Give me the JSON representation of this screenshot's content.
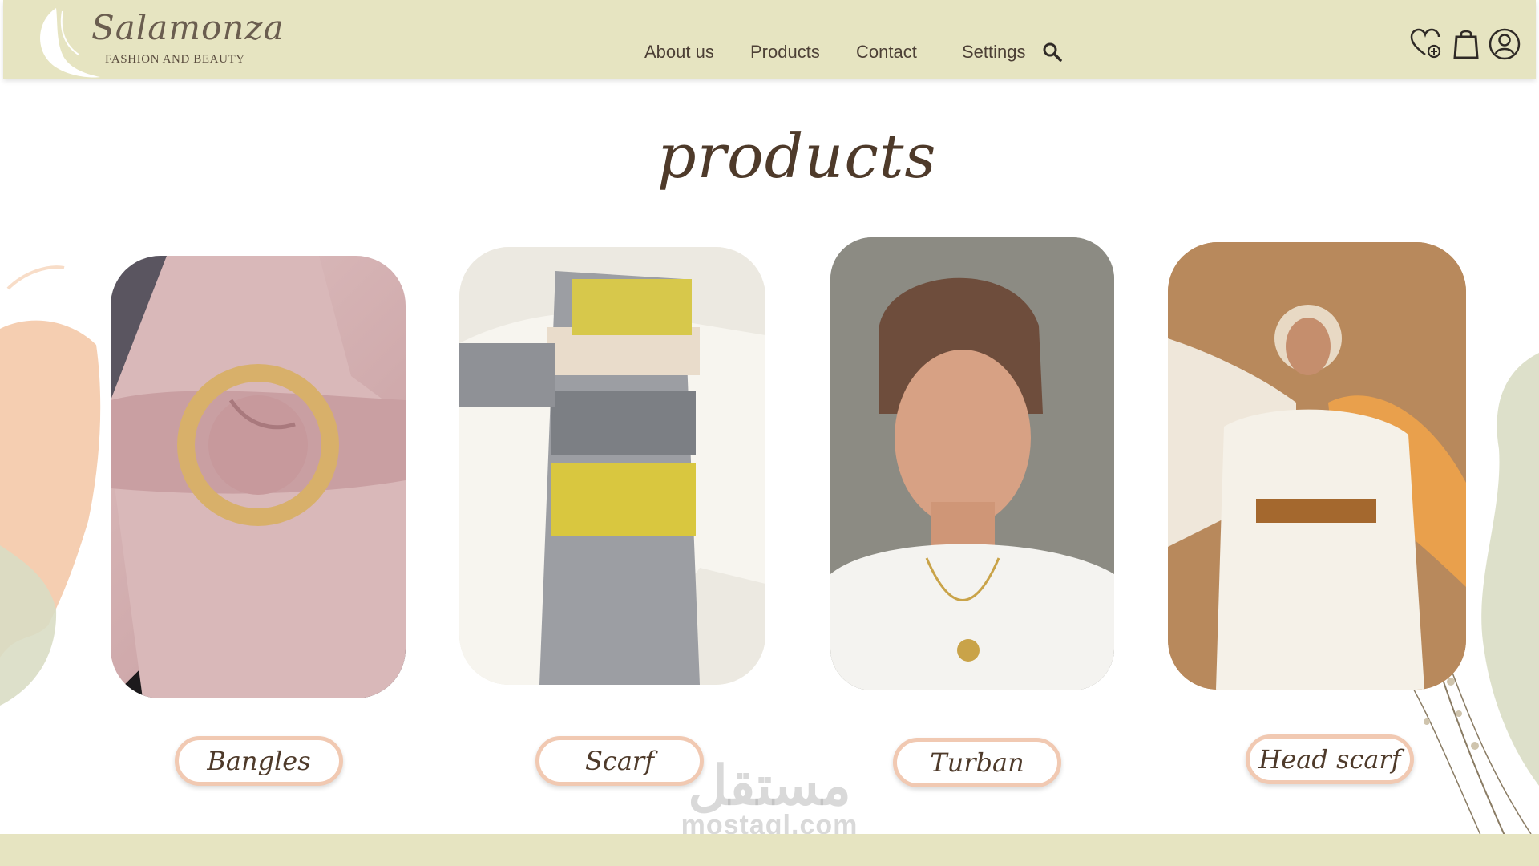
{
  "brand": {
    "name": "Salamonza",
    "tagline": "FASHION AND BEAUTY"
  },
  "nav": {
    "items": [
      {
        "label": "About us"
      },
      {
        "label": "Products"
      },
      {
        "label": "Contact"
      },
      {
        "label": "Settings"
      }
    ]
  },
  "header_icons": [
    "search-icon",
    "wishlist-heart-icon",
    "shopping-bag-icon",
    "user-account-icon"
  ],
  "page": {
    "title": "products"
  },
  "products": [
    {
      "label": "Bangles",
      "image": "pink scarf tied with gold ring"
    },
    {
      "label": "Scarf",
      "image": "grey and yellow knitted scarf"
    },
    {
      "label": "Turban",
      "image": "woman in brown turban"
    },
    {
      "label": "Head scarf",
      "image": "woman in animal print head scarf"
    }
  ],
  "watermark": {
    "arabic": "مستقل",
    "latin": "mostaql.com"
  },
  "colors": {
    "header_bg": "#e6e4c1",
    "title_brown": "#4e3a2a",
    "pill_border": "#f1c9b2",
    "peach_brush": "#f3c6a3",
    "sage_brush": "#d9ddc4"
  }
}
